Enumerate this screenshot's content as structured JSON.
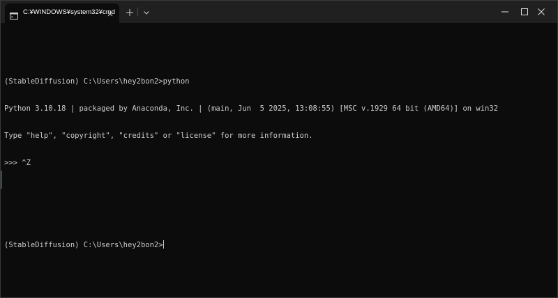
{
  "window": {
    "tab_title": "C:¥WINDOWS¥system32¥cmd",
    "tab_icon": "terminal-icon",
    "new_tab_icon": "plus-icon",
    "dropdown_icon": "chevron-down-icon",
    "caption_buttons": [
      "minimize-icon",
      "maximize-icon",
      "close-icon"
    ]
  },
  "console": {
    "lines": [
      "",
      "(StableDiffusion) C:\\Users\\hey2bon2>python",
      "Python 3.10.18 | packaged by Anaconda, Inc. | (main, Jun  5 2025, 13:08:55) [MSC v.1929 64 bit (AMD64)] on win32",
      "Type \"help\", \"copyright\", \"credits\" or \"license\" for more information.",
      ">>> ^Z",
      "",
      "",
      "(StableDiffusion) C:\\Users\\hey2bon2>"
    ]
  },
  "colors": {
    "background": "#0c0c0c",
    "titlebar": "#202020",
    "text": "#cccccc"
  }
}
